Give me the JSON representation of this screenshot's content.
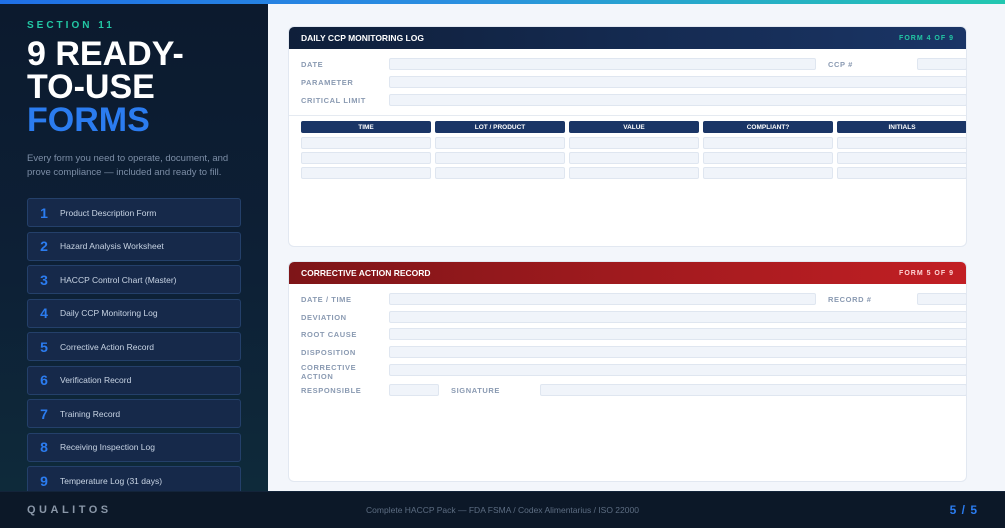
{
  "section_label": "SECTION 11",
  "title_line1": "9 READY-",
  "title_line2": "TO-USE",
  "title_accent": "FORMS",
  "description": "Every form you need to operate, document, and prove compliance — included and ready to fill.",
  "forms": [
    {
      "num": "1",
      "name": "Product Description Form"
    },
    {
      "num": "2",
      "name": "Hazard Analysis Worksheet"
    },
    {
      "num": "3",
      "name": "HACCP Control Chart (Master)"
    },
    {
      "num": "4",
      "name": "Daily CCP Monitoring Log"
    },
    {
      "num": "5",
      "name": "Corrective Action Record"
    },
    {
      "num": "6",
      "name": "Verification Record"
    },
    {
      "num": "7",
      "name": "Training Record"
    },
    {
      "num": "8",
      "name": "Receiving Inspection Log"
    },
    {
      "num": "9",
      "name": "Temperature Log (31 days)"
    }
  ],
  "card1": {
    "title": "DAILY CCP MONITORING LOG",
    "form_no": "FORM 4 OF 9",
    "labels": {
      "date": "DATE",
      "ccp": "CCP #",
      "parameter": "PARAMETER",
      "critical_limit": "CRITICAL LIMIT"
    },
    "columns": [
      "TIME",
      "LOT / PRODUCT",
      "VALUE",
      "COMPLIANT?",
      "INITIALS"
    ]
  },
  "card2": {
    "title": "CORRECTIVE ACTION RECORD",
    "form_no": "FORM 5 OF 9",
    "labels": {
      "date_time": "DATE / TIME",
      "record": "RECORD #",
      "deviation": "DEVIATION",
      "root_cause": "ROOT CAUSE",
      "disposition": "DISPOSITION",
      "corrective_action_1": "CORRECTIVE",
      "corrective_action_2": "ACTION",
      "responsible": "RESPONSIBLE",
      "signature": "SIGNATURE"
    }
  },
  "footer": {
    "brand": "QUALITOS",
    "text": "Complete HACCP Pack — FDA FSMA / Codex Alimentarius / ISO 22000",
    "page": "5 / 5"
  },
  "colors": {
    "accent_blue": "#2b7cf0",
    "accent_teal": "#22c7a4",
    "navy": "#1a3566",
    "red": "#c21f24"
  }
}
